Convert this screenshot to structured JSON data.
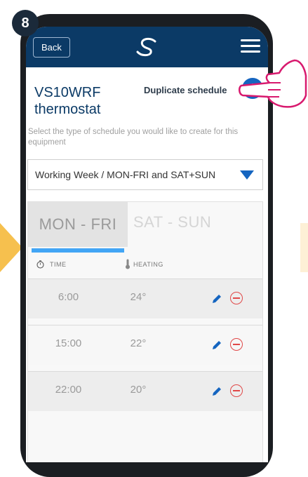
{
  "step_badge": "8",
  "header": {
    "back_label": "Back"
  },
  "device": {
    "title": "VS10WRF thermostat"
  },
  "duplicate": {
    "label": "Duplicate schedule",
    "plus_symbol": "+"
  },
  "subtitle": "Select the type of schedule you would like to create for this equipment",
  "schedule_type": {
    "selected": "Working Week / MON-FRI and SAT+SUN"
  },
  "tabs": [
    {
      "label": "MON - FRI",
      "active": true
    },
    {
      "label": "SAT - SUN",
      "active": false
    }
  ],
  "columns": {
    "time": "TIME",
    "heating": "HEATING"
  },
  "rows": [
    {
      "time": "6:00",
      "temp": "24°"
    },
    {
      "time": "15:00",
      "temp": "22°"
    },
    {
      "time": "22:00",
      "temp": "20°"
    }
  ],
  "colors": {
    "topbar": "#0b3a66",
    "accent": "#1565c0",
    "delete": "#e04848",
    "tab_underline": "#42a5f5",
    "callout_arrow": "#f6c04e",
    "hand": "#d8196e"
  }
}
